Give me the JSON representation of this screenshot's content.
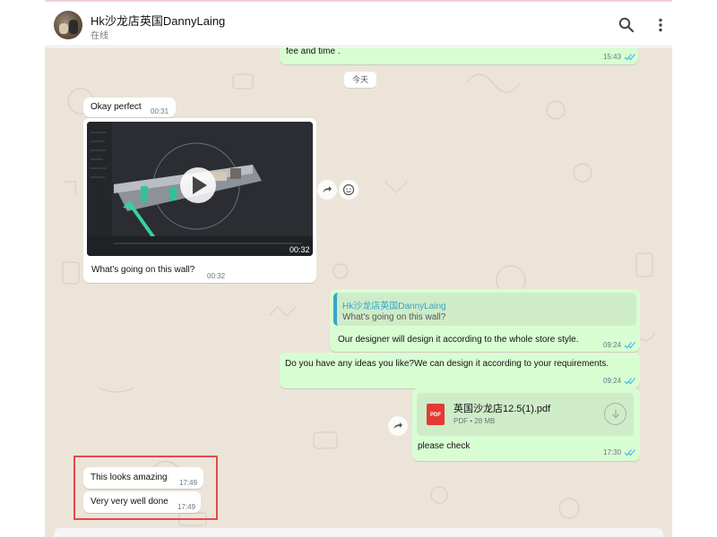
{
  "header": {
    "contact_name": "Hk沙龙店英国DannyLaing",
    "status": "在线",
    "search_icon": "search-icon",
    "menu_icon": "more-vertical-icon"
  },
  "chat": {
    "date_divider": "今天",
    "messages": [
      {
        "direction": "out",
        "text": "fee and time .",
        "time": "15:43",
        "status": "read"
      },
      {
        "direction": "in",
        "text": "Okay perfect",
        "time": "00:31"
      },
      {
        "direction": "in",
        "type": "video",
        "duration": "00:32",
        "caption": "What's going on this wall?",
        "time": "00:32"
      },
      {
        "direction": "out",
        "quote_author": "Hk沙龙店英国DannyLaing",
        "quote_text": "What's going on this wall?",
        "text": "Our designer will design it according to the whole store style.",
        "time": "09:24",
        "status": "read"
      },
      {
        "direction": "out",
        "text": "Do you have any ideas you like?We can design it according to your requirements.",
        "time": "09:24",
        "status": "read"
      },
      {
        "direction": "out",
        "type": "document",
        "file_name": "英国沙龙店12.5(1).pdf",
        "file_type": "PDF",
        "file_size": "28 MB",
        "caption": "please check",
        "time": "17:30",
        "status": "read"
      },
      {
        "direction": "in",
        "text": "This looks amazing",
        "time": "17:49"
      },
      {
        "direction": "in",
        "text": "Very very well done",
        "time": "17:49"
      }
    ]
  },
  "colors": {
    "incoming": "#ffffff",
    "outgoing": "#d9fdd3",
    "quote_accent": "#35a6c7",
    "read_ticks": "#53bdeb",
    "highlight_box": "#e34b4b",
    "chat_background": "#ece4d9"
  }
}
